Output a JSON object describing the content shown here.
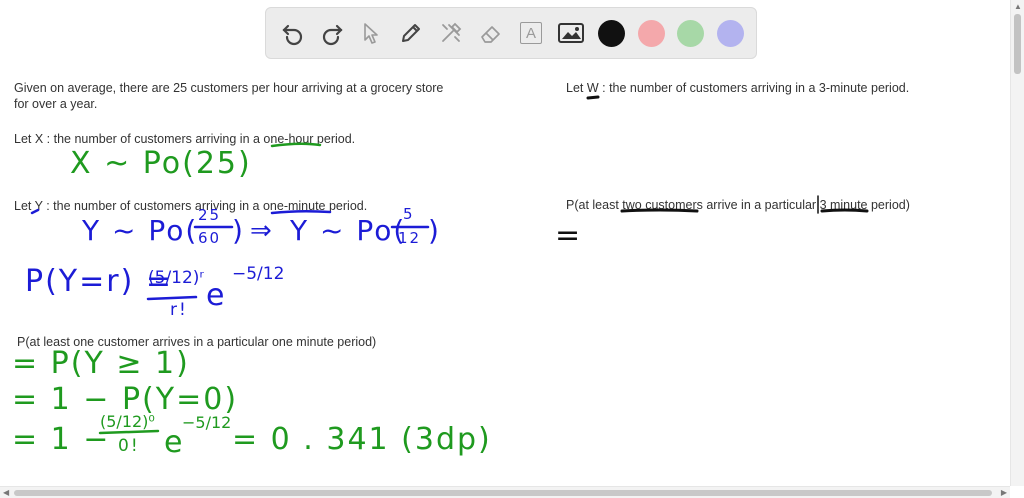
{
  "toolbar": {
    "tools": [
      {
        "icon": "undo-icon"
      },
      {
        "icon": "redo-icon"
      },
      {
        "icon": "select-arrow-icon"
      },
      {
        "icon": "pen-icon"
      },
      {
        "icon": "tools-icon"
      },
      {
        "icon": "eraser-icon"
      },
      {
        "icon": "text-icon",
        "glyph": "A"
      },
      {
        "icon": "image-icon"
      }
    ],
    "colors": [
      "#111111",
      "#f4a8ab",
      "#a7d8a7",
      "#b3b3ef"
    ]
  },
  "left": {
    "intro_line1": "Given on average, there are 25 customers per hour arriving at a grocery store",
    "intro_line2": "for over a year.",
    "letx": "Let X : the number of customers arriving in a one-hour period.",
    "lety": "Let Y : the number of customers arriving in a one-minute period.",
    "q1": "P(at least one customer arrives in a particular one minute period)"
  },
  "right": {
    "letw": "Let W : the number of customers arriving in a 3-minute period.",
    "q2": "P(at least two customers arrive in a particular 3 minute period)"
  },
  "handwriting": {
    "x_dist": "X ~ Po(25)",
    "y_dist_a": "Y ~ Po(",
    "y_frac_a_num": "25",
    "y_frac_a_den": "60",
    "implies": "⇒",
    "y_dist_b": "Y ~ Po(",
    "y_frac_b_num": "5",
    "y_frac_b_den": "12",
    "close_paren": ")",
    "pmf_lhs": "P(Y=r) =",
    "pmf_num": "(5/12)ʳ",
    "pmf_den": "r!",
    "pmf_exp_base": "e",
    "pmf_exp": "−5/12",
    "step1": "= P(Y ≥ 1)",
    "step2": "= 1 − P(Y=0)",
    "step3_a": "= 1 −",
    "step3_num": "(5/12)⁰",
    "step3_den": "0!",
    "step3_e": "e",
    "step3_exp": "−5/12",
    "step3_b": "= 0 . 341 (3dp)",
    "right_eq": "="
  }
}
